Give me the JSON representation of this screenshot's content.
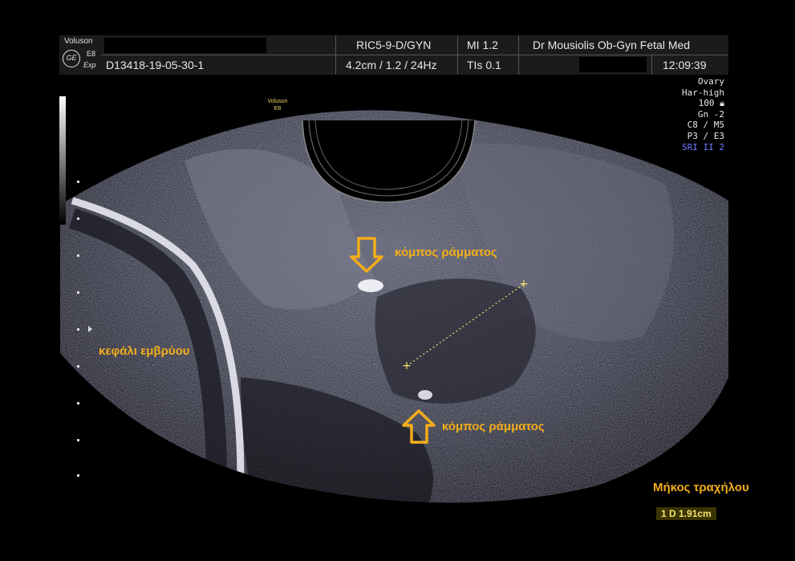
{
  "header": {
    "brand": "Voluson",
    "model": "E8",
    "mode_tag": "Exp",
    "logo_icon": "ge-logo-icon",
    "exam_id": "D13418-19-05-30-1",
    "probe": "RIC5-9-D/GYN",
    "depth_freq": "4.2cm / 1.2 / 24Hz",
    "mi": "MI  1.2",
    "tis": "TIs  0.1",
    "institution": "Dr Mousiolis Ob-Gyn Fetal Med",
    "time": "12:09:39"
  },
  "params": [
    "Ovary",
    "Har-high",
    "100",
    "Gn  -2",
    "C8 / M5",
    "P3 / E3"
  ],
  "params_lock_icon": "lock-icon",
  "params_highlight": "SRI II 2",
  "watermark": {
    "line1": "Voluson",
    "line2": "E8"
  },
  "annotations": {
    "knot_top": "κόμπος ράμματος",
    "knot_bottom": "κόμπος ράμματος",
    "fetal_head": "κεφάλι  εμβρύου"
  },
  "measurement": {
    "title": "Μήκος τραχήλου",
    "value": "1  D 1.91cm"
  },
  "colors": {
    "annotation": "#f2ad1a",
    "caliper": "#f4e070",
    "background": "#000000",
    "header": "#1b1b1b"
  }
}
